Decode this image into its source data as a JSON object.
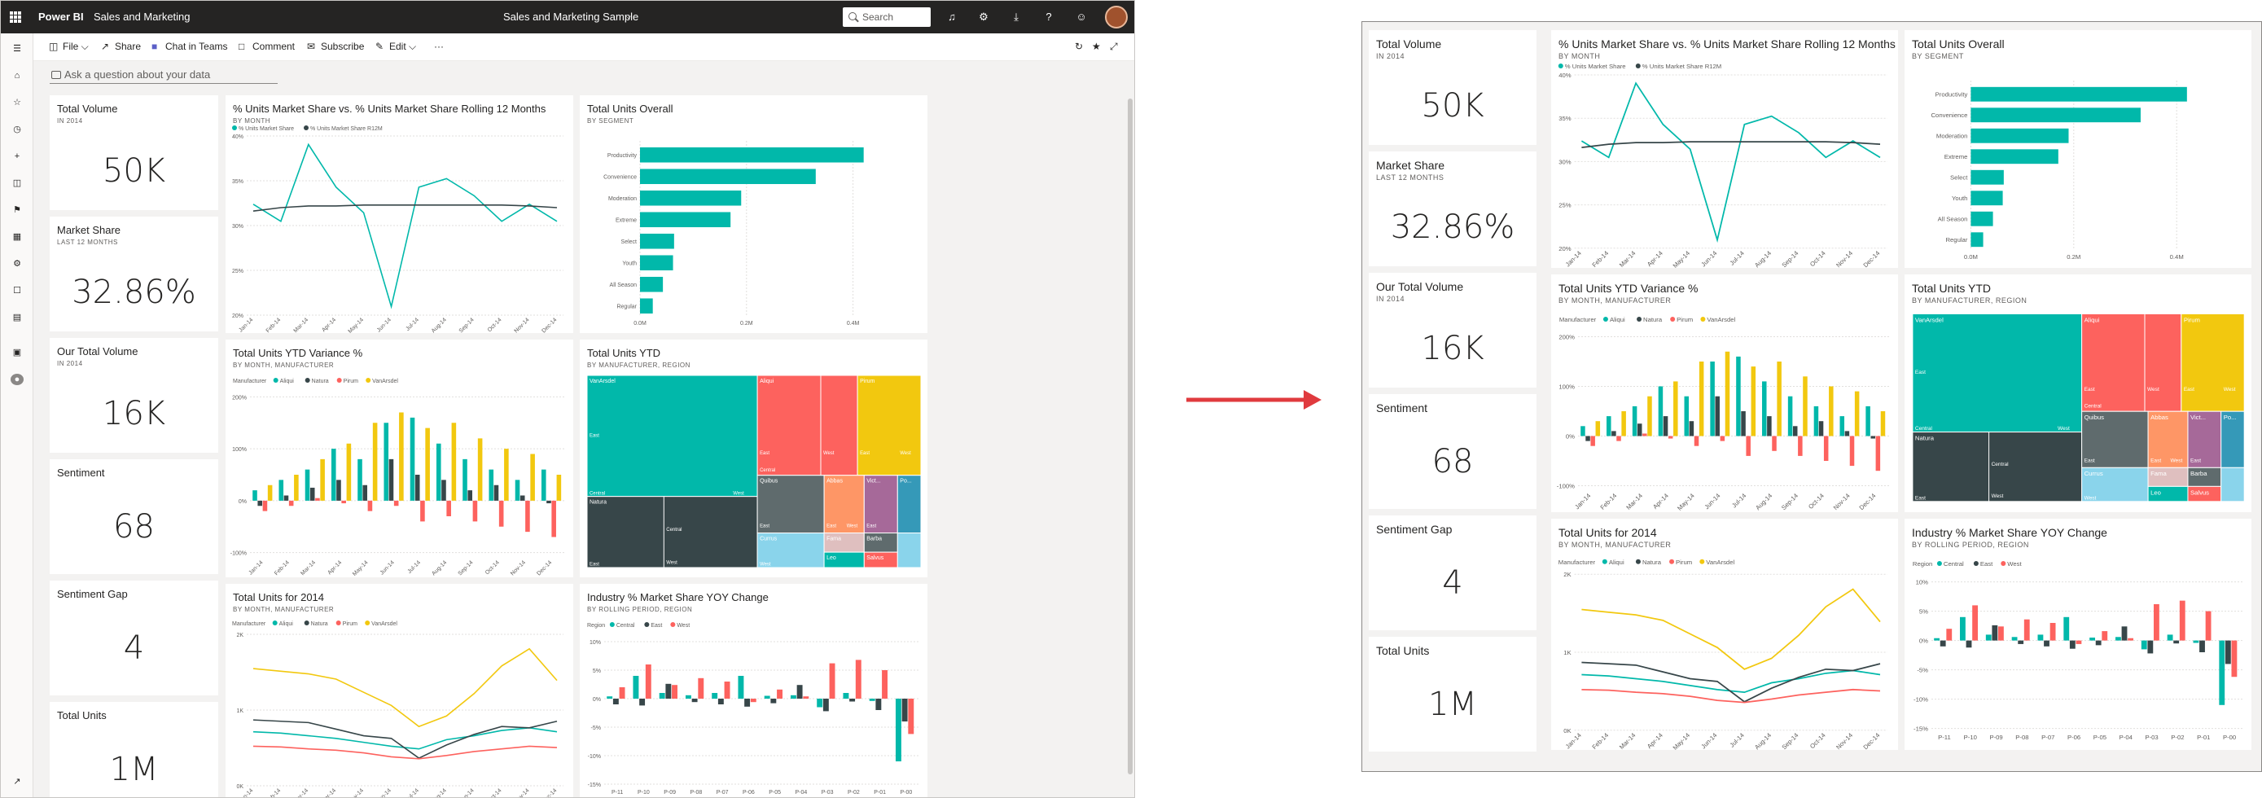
{
  "topbar": {
    "brand": "Power BI",
    "workspace": "Sales and Marketing",
    "report_title": "Sales and Marketing Sample",
    "search_placeholder": "Search"
  },
  "icons": {
    "waffle": "app-launcher-icon",
    "bell": "notifications-icon",
    "gear": "settings-icon",
    "download": "download-icon",
    "help": "help-icon",
    "feedback": "smiley-icon"
  },
  "commands": {
    "file": "File",
    "share": "Share",
    "teams": "Chat in Teams",
    "comment": "Comment",
    "subscribe": "Subscribe",
    "edit": "Edit",
    "more": "···"
  },
  "qna": {
    "placeholder": "Ask a question about your data"
  },
  "colors": {
    "teal": "#01b8aa",
    "black": "#374649",
    "red": "#fd625e",
    "yellow": "#f2c80f",
    "gray": "#5f6b6d",
    "blue": "#8ad4eb",
    "orange": "#fe9666",
    "purple": "#a66999",
    "darkblue": "#3599b8",
    "pink": "#dfbfbf",
    "topbar": "#252423"
  },
  "tiles": {
    "total_volume": {
      "title": "Total Volume",
      "subtitle": "IN 2014",
      "value": "50K"
    },
    "market_share": {
      "title": "Market Share",
      "subtitle": "LAST 12 MONTHS",
      "value": "32.86%"
    },
    "our_total_volume": {
      "title": "Our Total Volume",
      "subtitle": "IN 2014",
      "value": "16K"
    },
    "sentiment": {
      "title": "Sentiment",
      "value": "68"
    },
    "sentiment_gap": {
      "title": "Sentiment Gap",
      "value": "4"
    },
    "total_units": {
      "title": "Total Units",
      "value": "1M"
    },
    "market_share_line": {
      "title": "% Units Market Share vs. % Units Market Share Rolling 12 Months",
      "subtitle": "BY MONTH"
    },
    "total_units_overall": {
      "title": "Total Units Overall",
      "subtitle": "BY SEGMENT"
    },
    "ytd_variance": {
      "title": "Total Units YTD Variance %",
      "subtitle": "BY MONTH, MANUFACTURER"
    },
    "total_units_ytd": {
      "title": "Total Units YTD",
      "subtitle": "BY MANUFACTURER, REGION"
    },
    "total_units_2014": {
      "title": "Total Units for 2014",
      "subtitle": "BY MONTH, MANUFACTURER"
    },
    "industry_yoy": {
      "title": "Industry % Market Share YOY Change",
      "subtitle": "BY ROLLING PERIOD, REGION"
    }
  },
  "chart_data": [
    {
      "id": "market_share_line",
      "type": "line",
      "x": [
        "Jan-14",
        "Feb-14",
        "Mar-14",
        "Apr-14",
        "May-14",
        "Jun-14",
        "Jul-14",
        "Aug-14",
        "Sep-14",
        "Oct-14",
        "Nov-14",
        "Dec-14"
      ],
      "series": [
        {
          "name": "% Units Market Share",
          "color": "#01b8aa",
          "values": [
            33,
            31,
            40,
            35,
            32,
            21,
            35,
            36,
            34,
            31,
            33,
            31
          ]
        },
        {
          "name": "% Units Market Share R12M",
          "color": "#374649",
          "values": [
            32.2,
            32.6,
            32.8,
            32.8,
            32.9,
            32.9,
            32.9,
            32.9,
            32.9,
            32.9,
            32.8,
            32.6
          ]
        }
      ],
      "yticks": [
        "20%",
        "25%",
        "30%",
        "35%",
        "40%"
      ],
      "ylim": [
        20,
        41
      ]
    },
    {
      "id": "total_units_overall",
      "type": "bar",
      "orientation": "horizontal",
      "categories": [
        "Productivity",
        "Convenience",
        "Moderation",
        "Extreme",
        "Select",
        "Youth",
        "All Season",
        "Regular"
      ],
      "values": [
        0.42,
        0.33,
        0.19,
        0.17,
        0.064,
        0.062,
        0.043,
        0.024
      ],
      "xticks": [
        "0.0M",
        "0.2M",
        "0.4M"
      ],
      "xlim": [
        0,
        0.5
      ],
      "color": "#01b8aa"
    },
    {
      "id": "ytd_variance",
      "type": "bar",
      "legend_title": "Manufacturer",
      "categories": [
        "Jan-14",
        "Feb-14",
        "Mar-14",
        "Apr-14",
        "May-14",
        "Jun-14",
        "Jul-14",
        "Aug-14",
        "Sep-14",
        "Oct-14",
        "Nov-14",
        "Dec-14"
      ],
      "series": [
        {
          "name": "Aliqui",
          "color": "#01b8aa",
          "values": [
            20,
            40,
            60,
            100,
            80,
            150,
            160,
            110,
            80,
            60,
            40,
            60
          ]
        },
        {
          "name": "Natura",
          "color": "#374649",
          "values": [
            -10,
            10,
            25,
            40,
            30,
            80,
            50,
            40,
            20,
            30,
            10,
            -5
          ]
        },
        {
          "name": "Pirum",
          "color": "#fd625e",
          "values": [
            -20,
            -10,
            5,
            -5,
            -20,
            -10,
            -40,
            -30,
            -40,
            -50,
            -60,
            -70
          ]
        },
        {
          "name": "VanArsdel",
          "color": "#f2c80f",
          "values": [
            30,
            50,
            80,
            110,
            150,
            170,
            140,
            150,
            120,
            100,
            90,
            50
          ]
        }
      ],
      "yticks": [
        "-100%",
        "0%",
        "100%",
        "200%"
      ],
      "ylim": [
        -110,
        210
      ]
    },
    {
      "id": "total_units_ytd",
      "type": "treemap",
      "items": [
        {
          "name": "VanArsdel",
          "region": [
            "East",
            "Central",
            "West"
          ],
          "color": "#01b8aa"
        },
        {
          "name": "Aliqui",
          "region": [
            "East",
            "West",
            "Central"
          ],
          "color": "#fd625e"
        },
        {
          "name": "Pirum",
          "region": [
            "East",
            "West"
          ],
          "color": "#f2c80f"
        },
        {
          "name": "Natura",
          "region": [
            "East",
            "Central",
            "West"
          ],
          "color": "#374649"
        },
        {
          "name": "Quibus",
          "color": "#5f6b6d"
        },
        {
          "name": "Abbas",
          "color": "#fe9666"
        },
        {
          "name": "Vict...",
          "color": "#a66999"
        },
        {
          "name": "Po...",
          "color": "#3599b8"
        },
        {
          "name": "Currus",
          "color": "#8ad4eb"
        },
        {
          "name": "Fama",
          "color": "#dfbfbf"
        },
        {
          "name": "Barba",
          "color": "#5f6b6d"
        },
        {
          "name": "Leo",
          "color": "#01b8aa"
        },
        {
          "name": "Salvus",
          "color": "#fd625e"
        }
      ]
    },
    {
      "id": "total_units_2014",
      "type": "line",
      "legend_title": "Manufacturer",
      "x": [
        "Jan-14",
        "Feb-14",
        "Mar-14",
        "Apr-14",
        "May-14",
        "Jun-14",
        "Jul-14",
        "Aug-14",
        "Sep-14",
        "Oct-14",
        "Nov-14",
        "Dec-14"
      ],
      "series": [
        {
          "name": "Aliqui",
          "color": "#01b8aa",
          "values": [
            820,
            800,
            760,
            720,
            660,
            600,
            560,
            700,
            760,
            840,
            880,
            820
          ]
        },
        {
          "name": "Natura",
          "color": "#374649",
          "values": [
            1000,
            980,
            960,
            860,
            760,
            720,
            420,
            620,
            780,
            900,
            880,
            980
          ]
        },
        {
          "name": "Pirum",
          "color": "#fd625e",
          "values": [
            600,
            590,
            560,
            540,
            500,
            440,
            410,
            460,
            520,
            560,
            600,
            580
          ]
        },
        {
          "name": "VanArsdel",
          "color": "#f2c80f",
          "values": [
            1780,
            1740,
            1700,
            1620,
            1420,
            1220,
            900,
            1060,
            1400,
            1820,
            2080,
            1600
          ]
        }
      ],
      "yticks": [
        "0K",
        "1K",
        "2K"
      ],
      "ylim": [
        0,
        2300
      ]
    },
    {
      "id": "industry_yoy",
      "type": "bar",
      "legend_title": "Region",
      "categories": [
        "P-11",
        "P-10",
        "P-09",
        "P-08",
        "P-07",
        "P-06",
        "P-05",
        "P-04",
        "P-03",
        "P-02",
        "P-01",
        "P-00"
      ],
      "series": [
        {
          "name": "Central",
          "color": "#01b8aa",
          "values": [
            0.4,
            4.0,
            1.0,
            0.6,
            1.0,
            4.0,
            0.5,
            0.6,
            -1.5,
            1.0,
            -0.4,
            -11.0
          ]
        },
        {
          "name": "East",
          "color": "#374649",
          "values": [
            -1.0,
            -1.2,
            2.6,
            -0.6,
            -1.0,
            -1.4,
            -0.8,
            2.4,
            -2.2,
            -0.5,
            -2.0,
            -4.0
          ]
        },
        {
          "name": "West",
          "color": "#fd625e",
          "values": [
            2.0,
            6.0,
            2.4,
            3.6,
            3.0,
            -0.6,
            1.6,
            0.4,
            6.2,
            6.8,
            5.0,
            -6.2
          ]
        }
      ],
      "yticks": [
        "-15%",
        "-10%",
        "-5%",
        "0%",
        "5%",
        "10%"
      ],
      "ylim": [
        -15,
        11
      ]
    }
  ]
}
